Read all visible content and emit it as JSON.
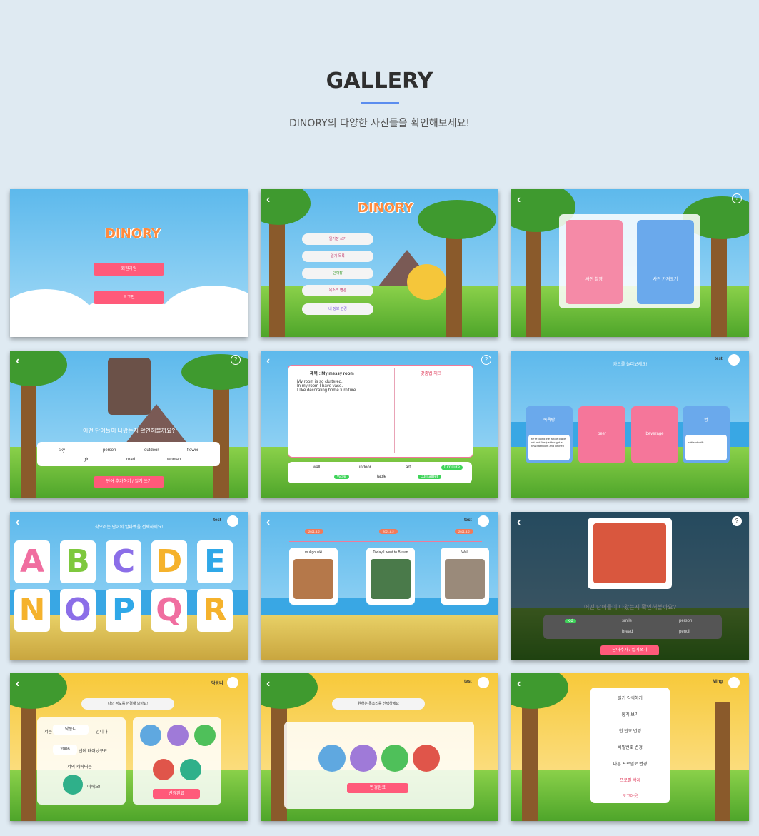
{
  "header": {
    "title": "GALLERY",
    "subtitle": "DINORY의 다양한 사진들을 확인해보세요!"
  },
  "shots": {
    "s1": {
      "logo": "DINORY",
      "signup": "회원가입",
      "login": "로그인"
    },
    "s2": {
      "logo": "DINORY",
      "menu": [
        "일기장 쓰기",
        "일기 목록",
        "단어장",
        "목소리 변경",
        "내 정보 변경"
      ]
    },
    "s3": {
      "take_photo": "사진 촬영",
      "load_photo": "사진 가져오기"
    },
    "s4": {
      "question": "어떤 단어들이 나왔는지 확인해볼까요?",
      "words": [
        "sky",
        "person",
        "outdoor",
        "flower",
        "girl",
        "road",
        "woman"
      ],
      "action": "단어 추가하기 / 일기 쓰기"
    },
    "s5": {
      "diary_title": "제목 : My messy room",
      "diary_body": "My room is so cluttered.\nIn my room I have vase.\nI like decorating home furniture.",
      "correction": "맞춤법 체크",
      "words": [
        "wall",
        "indoor",
        "art",
        "furniture",
        "vase",
        "table",
        "sink",
        "container"
      ]
    },
    "s6": {
      "prompt": "카드를 눌러보세요!",
      "user": "test",
      "cards": [
        "목욕탕",
        "beer",
        "beverage",
        "병"
      ],
      "hint1": "we're doing the whole place out and I've just bought a new bathroom and kitchen",
      "hint4": "bottle of milk"
    },
    "s7": {
      "prompt": "찾으려는 단어의 알파벳을 선택하세요!",
      "user": "test",
      "letters": [
        "A",
        "B",
        "C",
        "D",
        "E",
        "N",
        "O",
        "P",
        "Q",
        "R"
      ]
    },
    "s8": {
      "user": "test",
      "dates": [
        "2021.8.2",
        "2021.8.2",
        "2021.8.2"
      ],
      "titles": [
        "mukgoukki",
        "Today I went to Busan",
        "Wall"
      ]
    },
    "s9": {
      "question": "어떤 단어들이 나왔는지 확인해볼까요?",
      "action": "단어추가 / 일기쓰기",
      "words": [
        "kid",
        "smile",
        "person",
        "cup",
        "bread",
        "pencil"
      ]
    },
    "s10": {
      "user": "닥동니",
      "prompt": "나의 정보를 변경해 보아요!",
      "name_label": "저는",
      "name_value": "닥동니",
      "name_suffix": "입니다",
      "year_value": "2006",
      "year_suffix": "년에 태어났구요",
      "fav_label": "저의 캐릭터는",
      "fav_suffix": "이에요!",
      "save": "변경완료"
    },
    "s11": {
      "user": "test",
      "prompt": "원하는 목소리를 선택하세요",
      "save": "변경완료"
    },
    "s12": {
      "user": "Ming",
      "menu": [
        "일기 검색하기",
        "통계 보기",
        "한 번호 변경",
        "비밀번호 변경",
        "다른 프로필로 변경",
        "프로필 삭제",
        "로그아웃"
      ]
    }
  }
}
